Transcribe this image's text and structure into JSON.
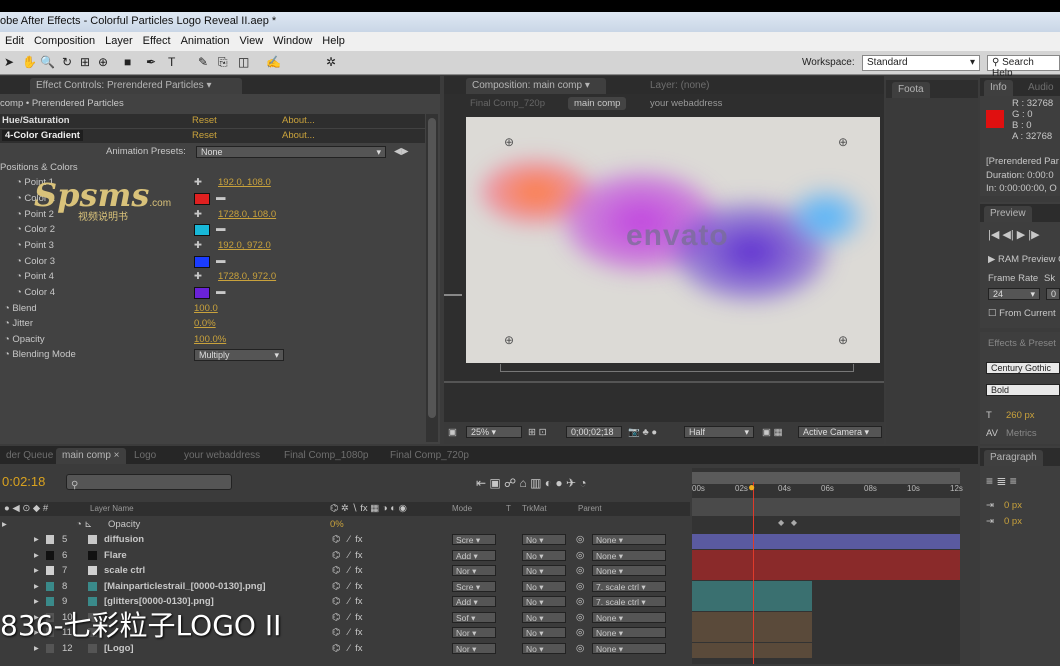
{
  "window": {
    "title": "obe After Effects - Colorful Particles Logo Reveal II.aep *"
  },
  "menu": [
    "Edit",
    "Composition",
    "Layer",
    "Effect",
    "Animation",
    "View",
    "Window",
    "Help"
  ],
  "workspace": {
    "label": "Workspace:",
    "value": "Standard"
  },
  "search_help": "Search Help",
  "effect_panel": {
    "tab": "Effect Controls: Prerendered Particles",
    "breadcrumb": "comp • Prerendered Particles",
    "effects": [
      {
        "name": "Hue/Saturation",
        "reset": "Reset",
        "about": "About..."
      },
      {
        "name": "4-Color Gradient",
        "reset": "Reset",
        "about": "About..."
      }
    ],
    "presets_label": "Animation Presets:",
    "presets_value": "None",
    "section": "Positions & Colors",
    "props": [
      {
        "label": "Point 1",
        "value": "192.0, 108.0"
      },
      {
        "label": "Color 1",
        "value": ""
      },
      {
        "label": "Point 2",
        "value": "1728.0, 108.0"
      },
      {
        "label": "Color 2",
        "value": ""
      },
      {
        "label": "Point 3",
        "value": "192.0, 972.0"
      },
      {
        "label": "Color 3",
        "value": ""
      },
      {
        "label": "Point 4",
        "value": "1728.0, 972.0"
      },
      {
        "label": "Color 4",
        "value": ""
      }
    ],
    "blend": {
      "label": "Blend",
      "value": "100.0"
    },
    "jitter": {
      "label": "Jitter",
      "value": "0.0%"
    },
    "opacity": {
      "label": "Opacity",
      "value": "100.0%"
    },
    "blending_mode": {
      "label": "Blending Mode",
      "value": "Multiply"
    },
    "colors": {
      "c1": "#e02020",
      "c2": "#18b8d8",
      "c3": "#1a3cff",
      "c4": "#6a22d8"
    }
  },
  "comp_panel": {
    "tab": "Composition: main comp",
    "layer_tab": "Layer: (none)",
    "crumbs": [
      "Final Comp_720p",
      "main comp",
      "your webaddress"
    ],
    "logo_text": "envato",
    "zoom": "25%",
    "timecode": "0;00;02;18",
    "resolution": "Half",
    "camera": "Active Camera"
  },
  "footage_tab": "Foota",
  "info": {
    "tab": "Info",
    "audio_tab": "Audio",
    "r": "R : 32768",
    "g": "G : 0",
    "b": "B : 0",
    "a": "A : 32768",
    "layer": "[Prerendered Par",
    "duration": "Duration: 0:00:0",
    "in": "In: 0:00:00:00, O",
    "swatch": "#e01010"
  },
  "preview": {
    "tab": "Preview",
    "ram": "RAM Preview O",
    "frame_rate": "Frame Rate",
    "skip": "Sk",
    "fps": "24",
    "skip_val": "0",
    "from_current": "From Current"
  },
  "effects_presets": "Effects & Preset",
  "character": {
    "font": "Century Gothic",
    "style": "Bold",
    "size": "260 px",
    "tracking": "Metrics"
  },
  "paragraph": {
    "tab": "Paragraph",
    "v1": "0 px",
    "v2": "0 px"
  },
  "timeline": {
    "tabs": [
      "der Queue",
      "main comp",
      "Logo",
      "your webaddress",
      "Final Comp_1080p",
      "Final Comp_720p"
    ],
    "timecode": "0:02:18",
    "col_layer": "Layer Name",
    "col_mode": "Mode",
    "col_t": "T",
    "col_trk": "TrkMat",
    "col_parent": "Parent",
    "opacity_label": "Opacity",
    "opacity_value": "0%",
    "ruler": [
      "00s",
      "02s",
      "04s",
      "06s",
      "08s",
      "10s",
      "12s"
    ],
    "layers": [
      {
        "num": "5",
        "name": "diffusion",
        "mode": "Scre",
        "trk": "No",
        "parent": "None",
        "color": "#c8c8c8",
        "bar": "#5a5aa0"
      },
      {
        "num": "6",
        "name": "Flare",
        "mode": "Add",
        "trk": "No",
        "parent": "None",
        "color": "#111111",
        "bar": "#8a2a2a"
      },
      {
        "num": "7",
        "name": "scale ctrl",
        "mode": "Nor",
        "trk": "No",
        "parent": "None",
        "color": "#d0d0d0",
        "bar": "#8a2a2a"
      },
      {
        "num": "8",
        "name": "[Mainparticlestrail_[0000-0130].png]",
        "mode": "Scre",
        "trk": "No",
        "parent": "7. scale ctrl",
        "color": "#3a8a8a",
        "bar": "#3a7070"
      },
      {
        "num": "9",
        "name": "[glitters[0000-0130].png]",
        "mode": "Add",
        "trk": "No",
        "parent": "7. scale ctrl",
        "color": "#3a8a8a",
        "bar": "#3a7070"
      },
      {
        "num": "10",
        "name": "",
        "mode": "Sof",
        "trk": "No",
        "parent": "None",
        "color": "#555555",
        "bar": "#5a4a3a"
      },
      {
        "num": "11",
        "name": "",
        "mode": "Nor",
        "trk": "No",
        "parent": "None",
        "color": "#555555",
        "bar": "#5a4a3a"
      },
      {
        "num": "12",
        "name": "[Logo]",
        "mode": "Nor",
        "trk": "No",
        "parent": "None",
        "color": "#555555",
        "bar": "#5a4a3a"
      }
    ]
  },
  "watermark": {
    "main": "Spsms",
    "dot": ".com",
    "sub": "视频说明书"
  },
  "overlay_caption": "836-七彩粒子LOGO II"
}
